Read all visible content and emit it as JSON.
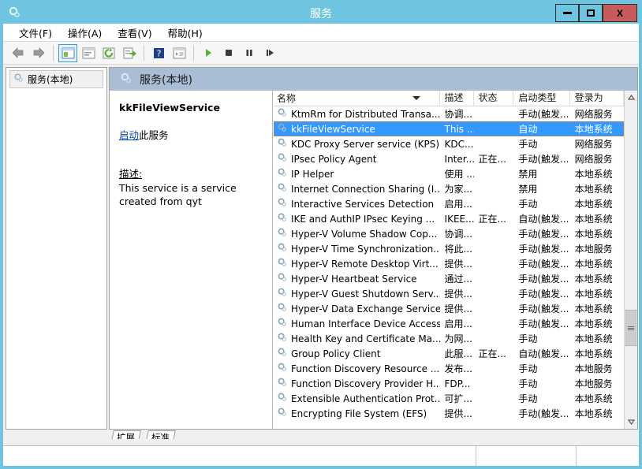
{
  "window": {
    "title": "服务",
    "icon": "services-gear-icon",
    "controls": {
      "minimize_label": "–",
      "maximize_label": "□",
      "close_label": "X"
    }
  },
  "menubar": {
    "items": [
      {
        "label": "文件(F)",
        "name": "menu-file"
      },
      {
        "label": "操作(A)",
        "name": "menu-action"
      },
      {
        "label": "查看(V)",
        "name": "menu-view"
      },
      {
        "label": "帮助(H)",
        "name": "menu-help"
      }
    ]
  },
  "toolbar": {
    "buttons": [
      {
        "icon": "back-arrow-icon",
        "name": "toolbar-back"
      },
      {
        "icon": "forward-arrow-icon",
        "name": "toolbar-forward"
      },
      {
        "icon": "show-hide-tree-icon",
        "name": "toolbar-show-tree",
        "active": true
      },
      {
        "icon": "properties-icon",
        "name": "toolbar-properties"
      },
      {
        "icon": "refresh-icon",
        "name": "toolbar-refresh"
      },
      {
        "icon": "export-list-icon",
        "name": "toolbar-export"
      },
      {
        "icon": "help-icon",
        "name": "toolbar-help"
      },
      {
        "icon": "details-view-icon",
        "name": "toolbar-details-view"
      },
      {
        "icon": "play-icon",
        "name": "toolbar-start-service"
      },
      {
        "icon": "stop-icon",
        "name": "toolbar-stop-service"
      },
      {
        "icon": "pause-icon",
        "name": "toolbar-pause-service"
      },
      {
        "icon": "restart-icon",
        "name": "toolbar-restart-service"
      }
    ]
  },
  "tree": {
    "root_label": "服务(本地)",
    "root_icon": "services-gear-icon"
  },
  "pane": {
    "header_title": "服务(本地)",
    "header_icon": "services-gear-icon"
  },
  "details": {
    "service_name": "kkFileViewService",
    "action_link": "启动",
    "action_suffix": "此服务",
    "description_label": "描述:",
    "description_text": "This service is a service created from qyt"
  },
  "list": {
    "columns": [
      {
        "label": "名称",
        "name": "column-name",
        "sorted": true
      },
      {
        "label": "描述",
        "name": "column-description"
      },
      {
        "label": "状态",
        "name": "column-status"
      },
      {
        "label": "启动类型",
        "name": "column-startup-type"
      },
      {
        "label": "登录为",
        "name": "column-log-on-as"
      }
    ],
    "rows": [
      {
        "name": "KtmRm for Distributed Transa...",
        "description": "协调...",
        "status": "",
        "startup": "手动(触发...",
        "logon": "网络服务",
        "selected": false
      },
      {
        "name": "kkFileViewService",
        "description": "This ...",
        "status": "",
        "startup": "自动",
        "logon": "本地系统",
        "selected": true
      },
      {
        "name": "KDC Proxy Server service (KPS)",
        "description": "KDC...",
        "status": "",
        "startup": "手动",
        "logon": "网络服务",
        "selected": false
      },
      {
        "name": "IPsec Policy Agent",
        "description": "Inter...",
        "status": "正在...",
        "startup": "手动(触发...",
        "logon": "网络服务",
        "selected": false
      },
      {
        "name": "IP Helper",
        "description": "使用 ...",
        "status": "",
        "startup": "禁用",
        "logon": "本地系统",
        "selected": false
      },
      {
        "name": "Internet Connection Sharing (I...",
        "description": "为家...",
        "status": "",
        "startup": "禁用",
        "logon": "本地系统",
        "selected": false
      },
      {
        "name": "Interactive Services Detection",
        "description": "启用...",
        "status": "",
        "startup": "手动",
        "logon": "本地系统",
        "selected": false
      },
      {
        "name": "IKE and AuthIP IPsec Keying ...",
        "description": "IKEE...",
        "status": "正在...",
        "startup": "自动(触发...",
        "logon": "本地系统",
        "selected": false
      },
      {
        "name": "Hyper-V Volume Shadow Cop...",
        "description": "协调...",
        "status": "",
        "startup": "手动(触发...",
        "logon": "本地系统",
        "selected": false
      },
      {
        "name": "Hyper-V Time Synchronization...",
        "description": "将此...",
        "status": "",
        "startup": "手动(触发...",
        "logon": "本地服务",
        "selected": false
      },
      {
        "name": "Hyper-V Remote Desktop Virt...",
        "description": "提供...",
        "status": "",
        "startup": "手动(触发...",
        "logon": "本地系统",
        "selected": false
      },
      {
        "name": "Hyper-V Heartbeat Service",
        "description": "通过...",
        "status": "",
        "startup": "手动(触发...",
        "logon": "本地系统",
        "selected": false
      },
      {
        "name": "Hyper-V Guest Shutdown Serv...",
        "description": "提供...",
        "status": "",
        "startup": "手动(触发...",
        "logon": "本地系统",
        "selected": false
      },
      {
        "name": "Hyper-V Data Exchange Service",
        "description": "提供...",
        "status": "",
        "startup": "手动(触发...",
        "logon": "本地系统",
        "selected": false
      },
      {
        "name": "Human Interface Device Access",
        "description": "启用...",
        "status": "",
        "startup": "手动(触发...",
        "logon": "本地系统",
        "selected": false
      },
      {
        "name": "Health Key and Certificate Ma...",
        "description": "为网...",
        "status": "",
        "startup": "手动",
        "logon": "本地系统",
        "selected": false
      },
      {
        "name": "Group Policy Client",
        "description": "此服...",
        "status": "正在...",
        "startup": "自动(触发...",
        "logon": "本地系统",
        "selected": false
      },
      {
        "name": "Function Discovery Resource ...",
        "description": "发布...",
        "status": "",
        "startup": "手动",
        "logon": "本地服务",
        "selected": false
      },
      {
        "name": "Function Discovery Provider H...",
        "description": "FDP...",
        "status": "",
        "startup": "手动",
        "logon": "本地服务",
        "selected": false
      },
      {
        "name": "Extensible Authentication Prot...",
        "description": "可扩...",
        "status": "",
        "startup": "手动",
        "logon": "本地系统",
        "selected": false
      },
      {
        "name": "Encrypting File System (EFS)",
        "description": "提供...",
        "status": "",
        "startup": "手动(触发...",
        "logon": "本地系统",
        "selected": false
      }
    ],
    "scroll": {
      "up_glyph": "▲",
      "down_glyph": "▼"
    }
  },
  "tabs": [
    {
      "label": "扩展",
      "name": "tab-extended",
      "selected": false
    },
    {
      "label": "标准",
      "name": "tab-standard",
      "selected": true
    }
  ],
  "statusbar": {
    "left_text": "",
    "middle_text": "",
    "right_text": ""
  },
  "colors": {
    "titlebar": "#6fc5e0",
    "selection": "#3399ff",
    "pane_header": "#a9bdd4",
    "close_button": "#c75b5b",
    "link": "#0645ad"
  }
}
